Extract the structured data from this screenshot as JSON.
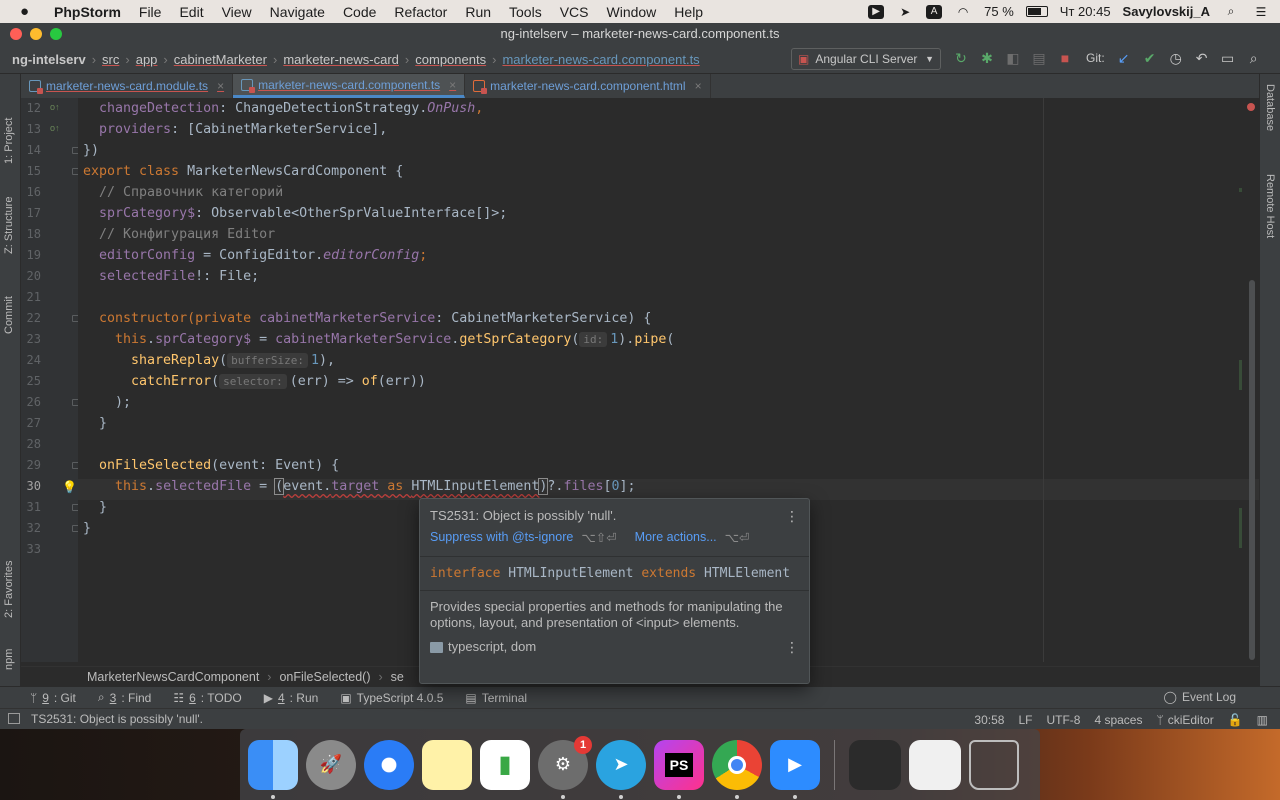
{
  "menubar": {
    "app_name": "PhpStorm",
    "items": [
      "File",
      "Edit",
      "View",
      "Navigate",
      "Code",
      "Refactor",
      "Run",
      "Tools",
      "VCS",
      "Window",
      "Help"
    ],
    "battery": "75 %",
    "clock": "Чт 20:45",
    "user": "Savylovskij_A"
  },
  "window": {
    "title": "ng-intelserv – marketer-news-card.component.ts"
  },
  "navbar": {
    "crumbs": [
      "ng-intelserv",
      "src",
      "app",
      "cabinetMarketer",
      "marketer-news-card",
      "components",
      "marketer-news-card.component.ts"
    ],
    "run_config": "Angular CLI Server",
    "git_label": "Git:"
  },
  "tabs": [
    {
      "label": "marketer-news-card.module.ts"
    },
    {
      "label": "marketer-news-card.component.ts"
    },
    {
      "label": "marketer-news-card.component.html"
    }
  ],
  "left_tools": [
    "1: Project",
    "Z: Structure",
    "Commit",
    "2: Favorites",
    "npm"
  ],
  "right_tools": [
    "Database",
    "Remote Host"
  ],
  "editor": {
    "line_numbers": [
      "12",
      "13",
      "14",
      "15",
      "16",
      "17",
      "18",
      "19",
      "20",
      "21",
      "22",
      "23",
      "24",
      "25",
      "26",
      "27",
      "28",
      "29",
      "30",
      "31",
      "32",
      "33"
    ],
    "current_line": "30",
    "code": {
      "l12a": "  changeDetection",
      "l12b": ": ChangeDetectionStrategy.",
      "l12c": "OnPush",
      "l12d": ",",
      "l13a": "  providers",
      "l13b": ": [CabinetMarketerService],",
      "l14": "})",
      "l15a": "export class ",
      "l15b": "MarketerNewsCardComponent {",
      "l16": "  // Справочник категорий",
      "l17a": "  sprCategory$",
      "l17b": ": Observable<OtherSprValueInterface[]>;",
      "l18": "  // Конфигурация Editor",
      "l19a": "  editorConfig",
      "l19b": " = ConfigEditor.",
      "l19c": "editorConfig",
      "l19d": ";",
      "l20a": "  selectedFile",
      "l20b": "!: File;",
      "l22a": "  constructor(",
      "l22b": "private ",
      "l22c": "cabinetMarketerService",
      "l22d": ": CabinetMarketerService) {",
      "l23a": "    this",
      "l23b": ".",
      "l23c": "sprCategory$",
      "l23d": " = ",
      "l23e": "cabinetMarketerService",
      "l23f": ".",
      "l23g": "getSprCategory",
      "l23h": "(",
      "l23i": "id:",
      "l23j": "1",
      "l23k": ").",
      "l23l": "pipe",
      "l23m": "(",
      "l24a": "      shareReplay",
      "l24b": "(",
      "l24c": "bufferSize:",
      "l24d": "1",
      "l24e": "),",
      "l25a": "      catchError",
      "l25b": "(",
      "l25c": "selector:",
      "l25d": "(err) => ",
      "l25e": "of",
      "l25f": "(err))",
      "l26": "    );",
      "l27": "  }",
      "l29a": "  onFileSelected",
      "l29b": "(event: Event) {",
      "l30a": "    this",
      "l30b": ".",
      "l30c": "selectedFile",
      "l30d": " = ",
      "l30e": "(",
      "l30f": "event.",
      "l30g": "target ",
      "l30h": "as ",
      "l30i": "HTMLInputElement",
      "l30j": ")",
      "l30k": "?.",
      "l30l": "files",
      "l30m": "[",
      "l30n": "0",
      "l30o": "];",
      "l31": "  }",
      "l32": "}"
    }
  },
  "popup": {
    "error": "TS2531: Object is possibly 'null'.",
    "suppress": "Suppress with @ts-ignore",
    "suppress_shortcut": "⌥⇧⏎",
    "more_actions": "More actions...",
    "more_shortcut": "⌥⏎",
    "sig_kw1": "interface ",
    "sig_name": "HTMLInputElement ",
    "sig_kw2": "extends ",
    "sig_parent": "HTMLElement",
    "description": "Provides special properties and methods for manipulating the options, layout, and presentation of <input> elements.",
    "library": "typescript, dom"
  },
  "code_crumbs": [
    "MarketerNewsCardComponent",
    "onFileSelected()",
    "se"
  ],
  "bottom_tools": [
    {
      "key": "9",
      "rest": ": Git"
    },
    {
      "key": "3",
      "rest": ": Find"
    },
    {
      "key": "6",
      "rest": ": TODO"
    },
    {
      "key": "4",
      "rest": ": Run"
    },
    {
      "key": "",
      "rest": "TypeScript 4.0.5"
    },
    {
      "key": "",
      "rest": "Terminal"
    }
  ],
  "event_log": "Event Log",
  "status": {
    "message": "TS2531: Object is possibly 'null'.",
    "position": "30:58",
    "line_sep": "LF",
    "encoding": "UTF-8",
    "indent": "4 spaces",
    "branch": "ckiEditor"
  },
  "dock": {
    "settings_badge": "1",
    "phpstorm_label": "PS",
    "apps": [
      "finder-icon",
      "launchpad-icon",
      "safari-icon",
      "notes-icon",
      "numbers-icon",
      "system-preferences-icon",
      "telegram-icon",
      "phpstorm-icon",
      "chrome-icon",
      "zoom-icon"
    ]
  },
  "colors": {
    "keyword": "#cc7832",
    "field": "#9876aa",
    "function": "#ffc66d",
    "number": "#6897bb",
    "comment": "#808080",
    "link": "#589df6",
    "error": "#c75450"
  }
}
